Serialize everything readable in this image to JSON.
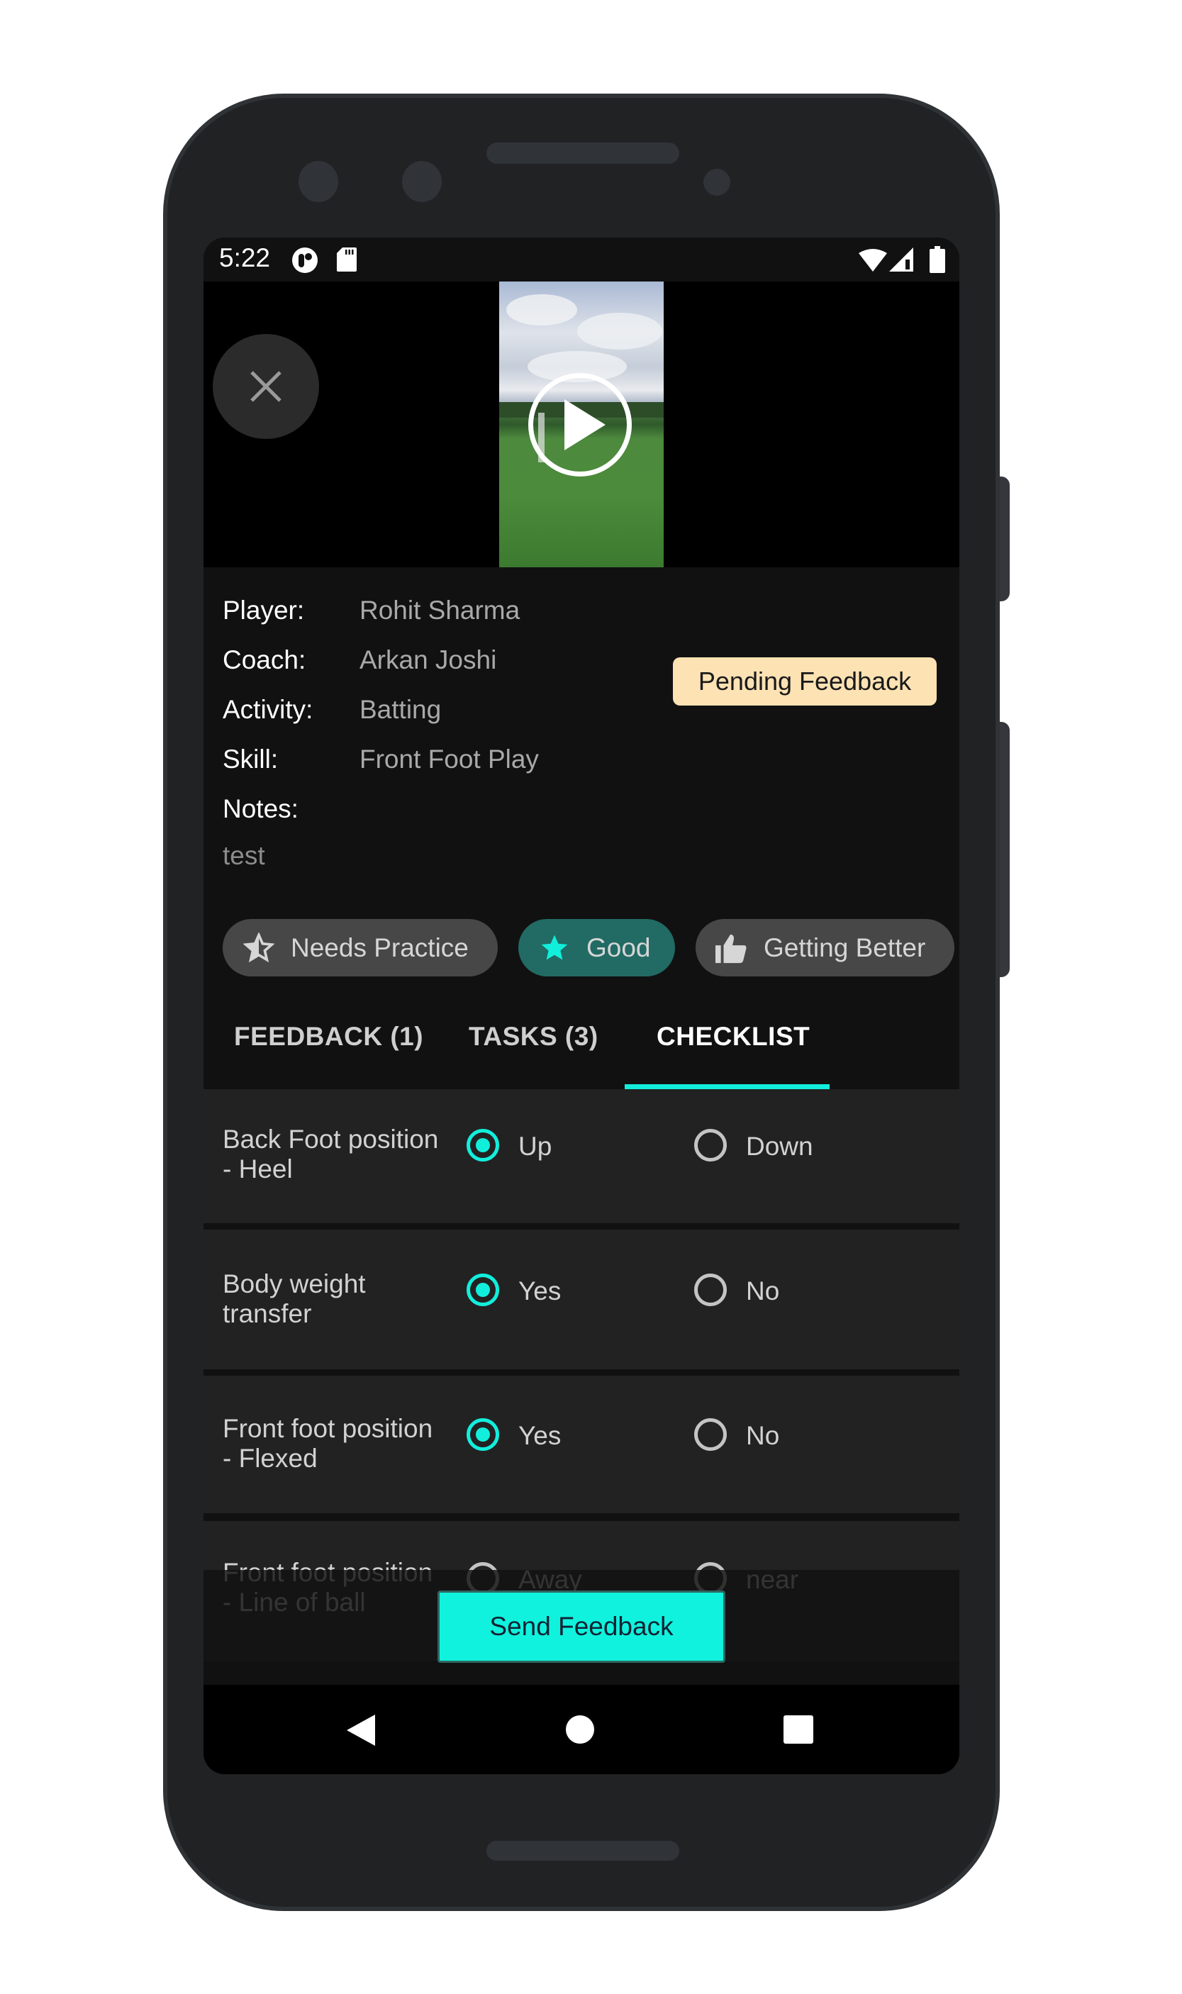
{
  "status_bar": {
    "time": "5:22",
    "left_icons": [
      "app-notification-icon",
      "sd-card-icon"
    ],
    "right_icons": [
      "wifi-icon",
      "cell-signal-icon",
      "battery-icon"
    ]
  },
  "video": {
    "close_icon": "close-icon",
    "play_icon": "play-icon"
  },
  "info": {
    "player_label": "Player:",
    "player_value": "Rohit Sharma",
    "coach_label": "Coach:",
    "coach_value": "Arkan Joshi",
    "activity_label": "Activity:",
    "activity_value": "Batting",
    "skill_label": "Skill:",
    "skill_value": "Front Foot Play",
    "notes_label": "Notes:",
    "notes_value": "test",
    "status_badge": "Pending Feedback"
  },
  "ratings": [
    {
      "label": "Needs Practice",
      "icon": "half-star-icon",
      "selected": false
    },
    {
      "label": "Good",
      "icon": "star-icon",
      "selected": true
    },
    {
      "label": "Getting Better",
      "icon": "thumbs-up-icon",
      "selected": false
    }
  ],
  "tabs": [
    {
      "label": "FEEDBACK (1)",
      "active": false
    },
    {
      "label": "TASKS (3)",
      "active": false
    },
    {
      "label": "CHECKLIST",
      "active": true
    }
  ],
  "checklist": [
    {
      "label_line1": "Back Foot position",
      "label_line2": "- Heel",
      "option_a": "Up",
      "option_b": "Down",
      "selected": "a"
    },
    {
      "label_line1": "Body weight",
      "label_line2": "transfer",
      "option_a": "Yes",
      "option_b": "No",
      "selected": "a"
    },
    {
      "label_line1": "Front foot position",
      "label_line2": "- Flexed",
      "option_a": "Yes",
      "option_b": "No",
      "selected": "a"
    },
    {
      "label_line1": "Front foot position",
      "label_line2": "- Line of ball",
      "option_a": "Away",
      "option_b": "near",
      "selected": null
    }
  ],
  "actions": {
    "send_feedback": "Send Feedback"
  },
  "nav": {
    "back": "back-icon",
    "home": "home-icon",
    "recents": "recents-icon"
  },
  "colors": {
    "accent": "#12eedc",
    "badge_bg": "#fde2b4",
    "chip_selected": "#216b64",
    "chip_default": "#474747",
    "background": "#111111",
    "row_bg": "#222222"
  }
}
